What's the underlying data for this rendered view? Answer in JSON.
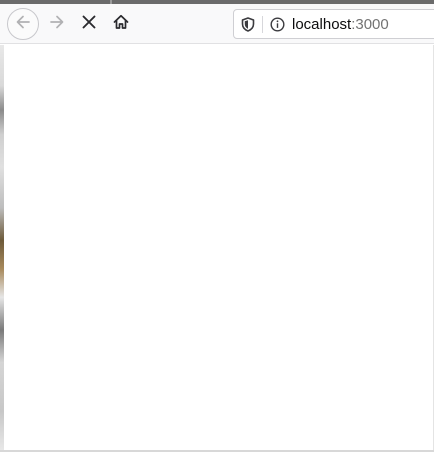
{
  "toolbar": {
    "back_icon": "arrow-left-icon",
    "forward_icon": "arrow-right-icon",
    "stop_icon": "close-icon",
    "home_icon": "home-icon"
  },
  "urlbar": {
    "host": "localhost",
    "port": ":3000",
    "tracking_icon": "shield-icon",
    "info_icon": "info-icon"
  },
  "colors": {
    "toolbar_bg": "#f9f9fa",
    "icon": "#0c0c0d",
    "icon_disabled": "#b1b1b3",
    "url_port": "#737373"
  }
}
